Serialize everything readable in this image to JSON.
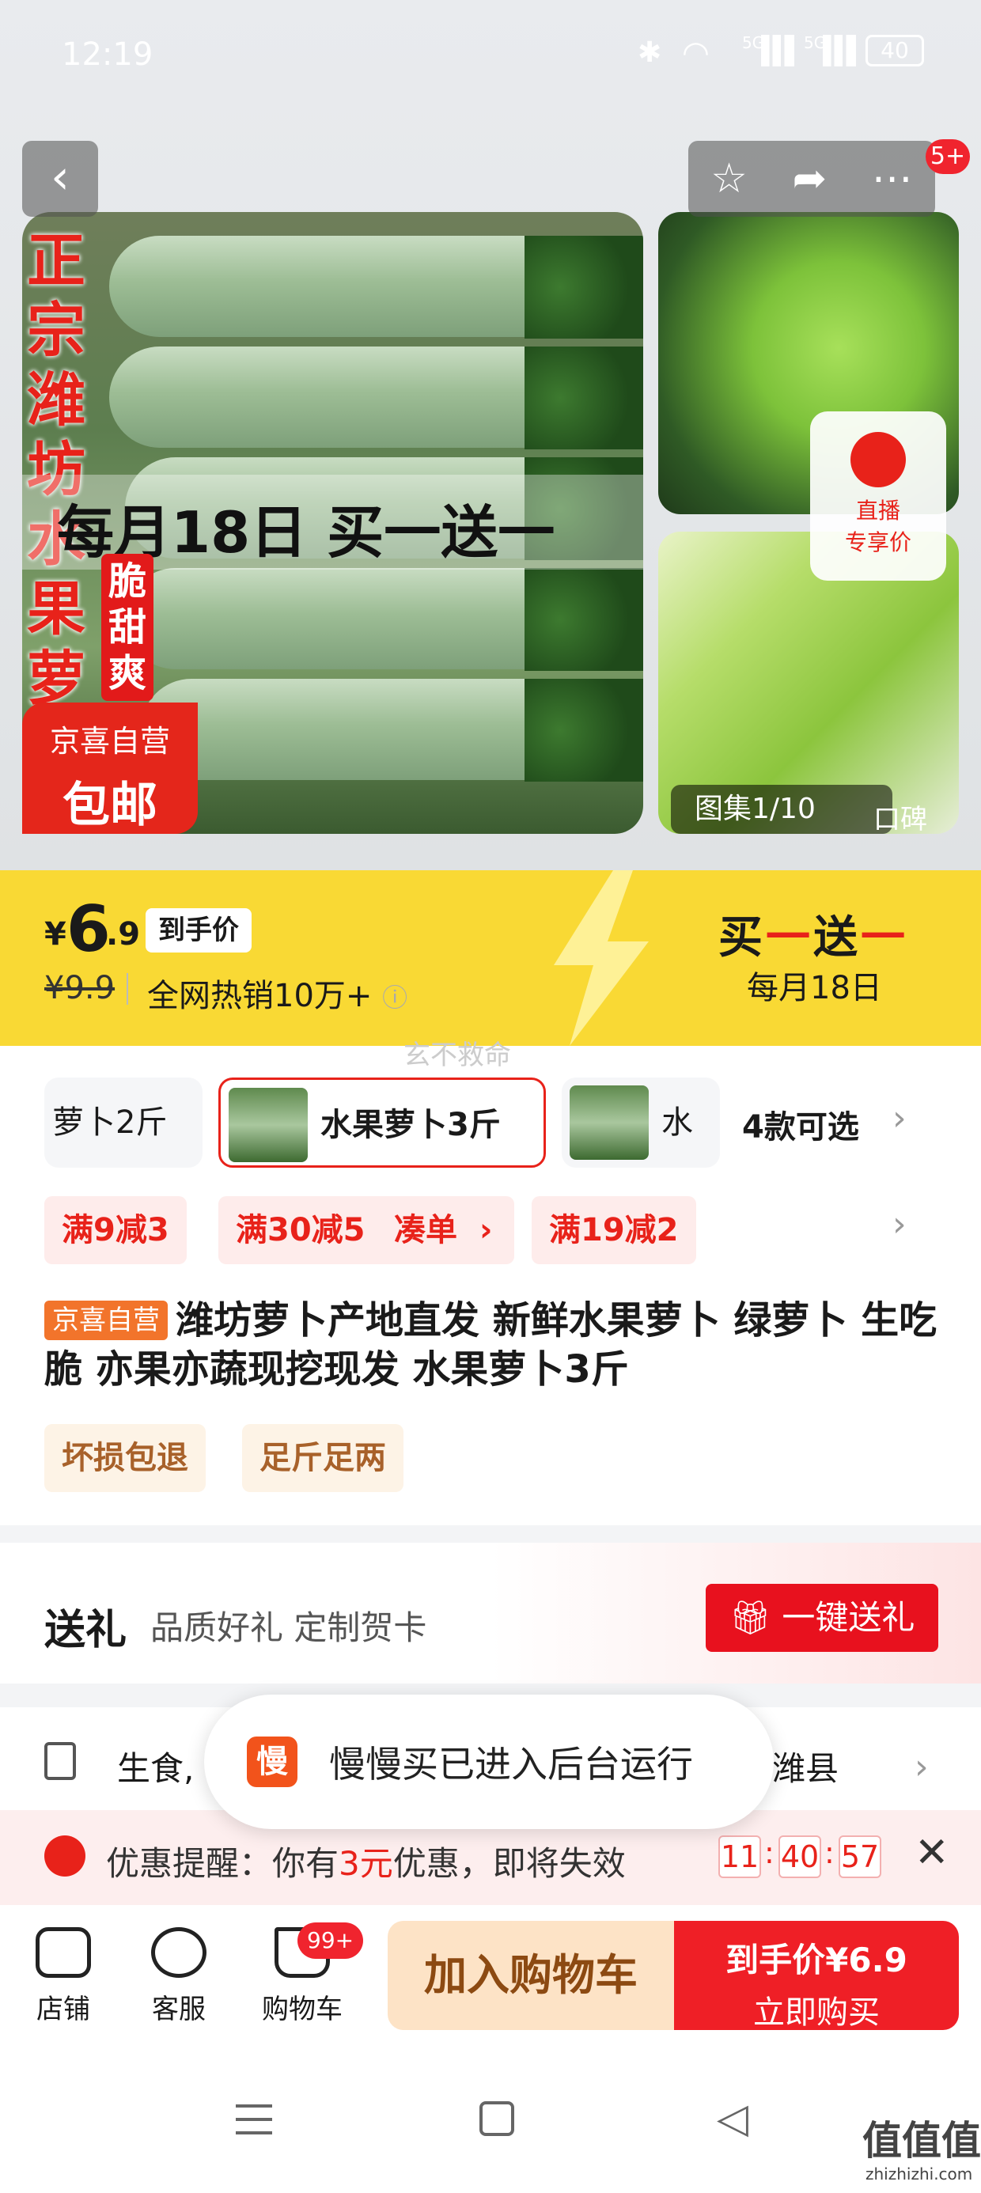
{
  "status": {
    "time": "12:19",
    "signal1": "5G",
    "signal2": "5G",
    "battery": "40"
  },
  "header": {
    "notif_badge": "5+"
  },
  "gallery": {
    "vertical_title": "正宗潍坊水果萝卜",
    "banner": "每月18日 买一送一",
    "crisp_tag": "脆甜爽",
    "self_tag_line1": "京喜自营",
    "self_tag_line2": "包邮",
    "live_line1": "直播",
    "live_line2": "专享价",
    "counter": "图集1/10",
    "koubei": "口碑"
  },
  "price": {
    "currency": "¥",
    "integer": "6",
    "decimal": ".9",
    "tag": "到手价",
    "original": "¥9.9",
    "sales": "全网热销10万+",
    "promo_a": "买",
    "promo_b": "一",
    "promo_c": "送",
    "promo_d": "一",
    "promo_date": "每月18日"
  },
  "watermark": "玄不救命",
  "specs": {
    "items": [
      "萝卜2斤",
      "水果萝卜3斤",
      "水果"
    ],
    "count_label": "4款可选"
  },
  "coupons": [
    "满9减3",
    "满30减5",
    "凑单",
    "满19减2"
  ],
  "product": {
    "tag": "京喜自营",
    "title": "潍坊萝卜产地直发 新鲜水果萝卜 绿萝卜 生吃脆 亦果亦蔬现挖现发 水果萝卜3斤",
    "services": [
      "坏损包退",
      "足斤足两"
    ]
  },
  "gift": {
    "title": "送礼",
    "subtitle": "品质好礼 定制贺卡",
    "button": "一键送礼"
  },
  "address": {
    "left": "生食,",
    "right": "潍县"
  },
  "toast": {
    "icon_char": "慢",
    "text": "慢慢买已进入后台运行"
  },
  "reminder": {
    "prefix": "优惠提醒：你有",
    "amount": "3元",
    "suffix": "优惠，即将失效",
    "h": "11",
    "m": "40",
    "s": "57"
  },
  "bottom": {
    "store": "店铺",
    "service": "客服",
    "cart": "购物车",
    "cart_badge": "99+",
    "add_cart": "加入购物车",
    "buy_price_label": "到手价¥6.9",
    "buy_now": "立即购买"
  },
  "footer_watermark": "值值值",
  "footer_url": "zhizhizhi.com",
  "colors": {
    "accent": "#e8221a",
    "price_bar": "#f9d934",
    "cart_btn": "#fde3c6"
  }
}
